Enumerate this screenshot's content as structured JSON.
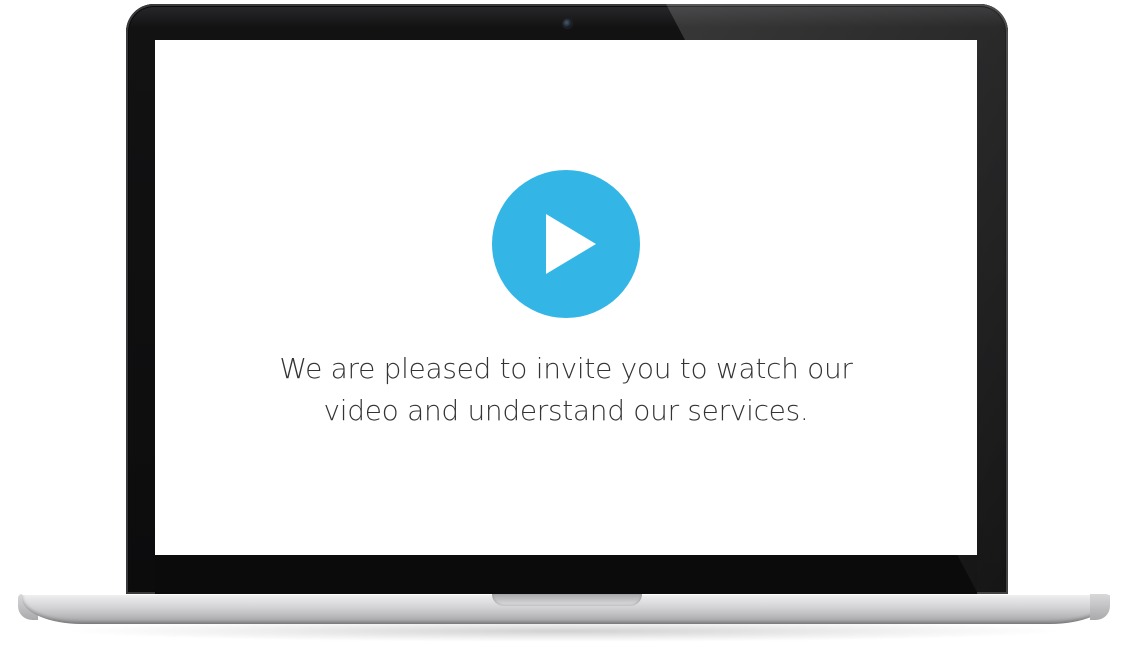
{
  "video_promo": {
    "invite_line_1": "We are pleased to invite you to watch our",
    "invite_line_2": "video and understand our services.",
    "play_icon": "play-icon",
    "accent_color": "#33b5e5"
  }
}
